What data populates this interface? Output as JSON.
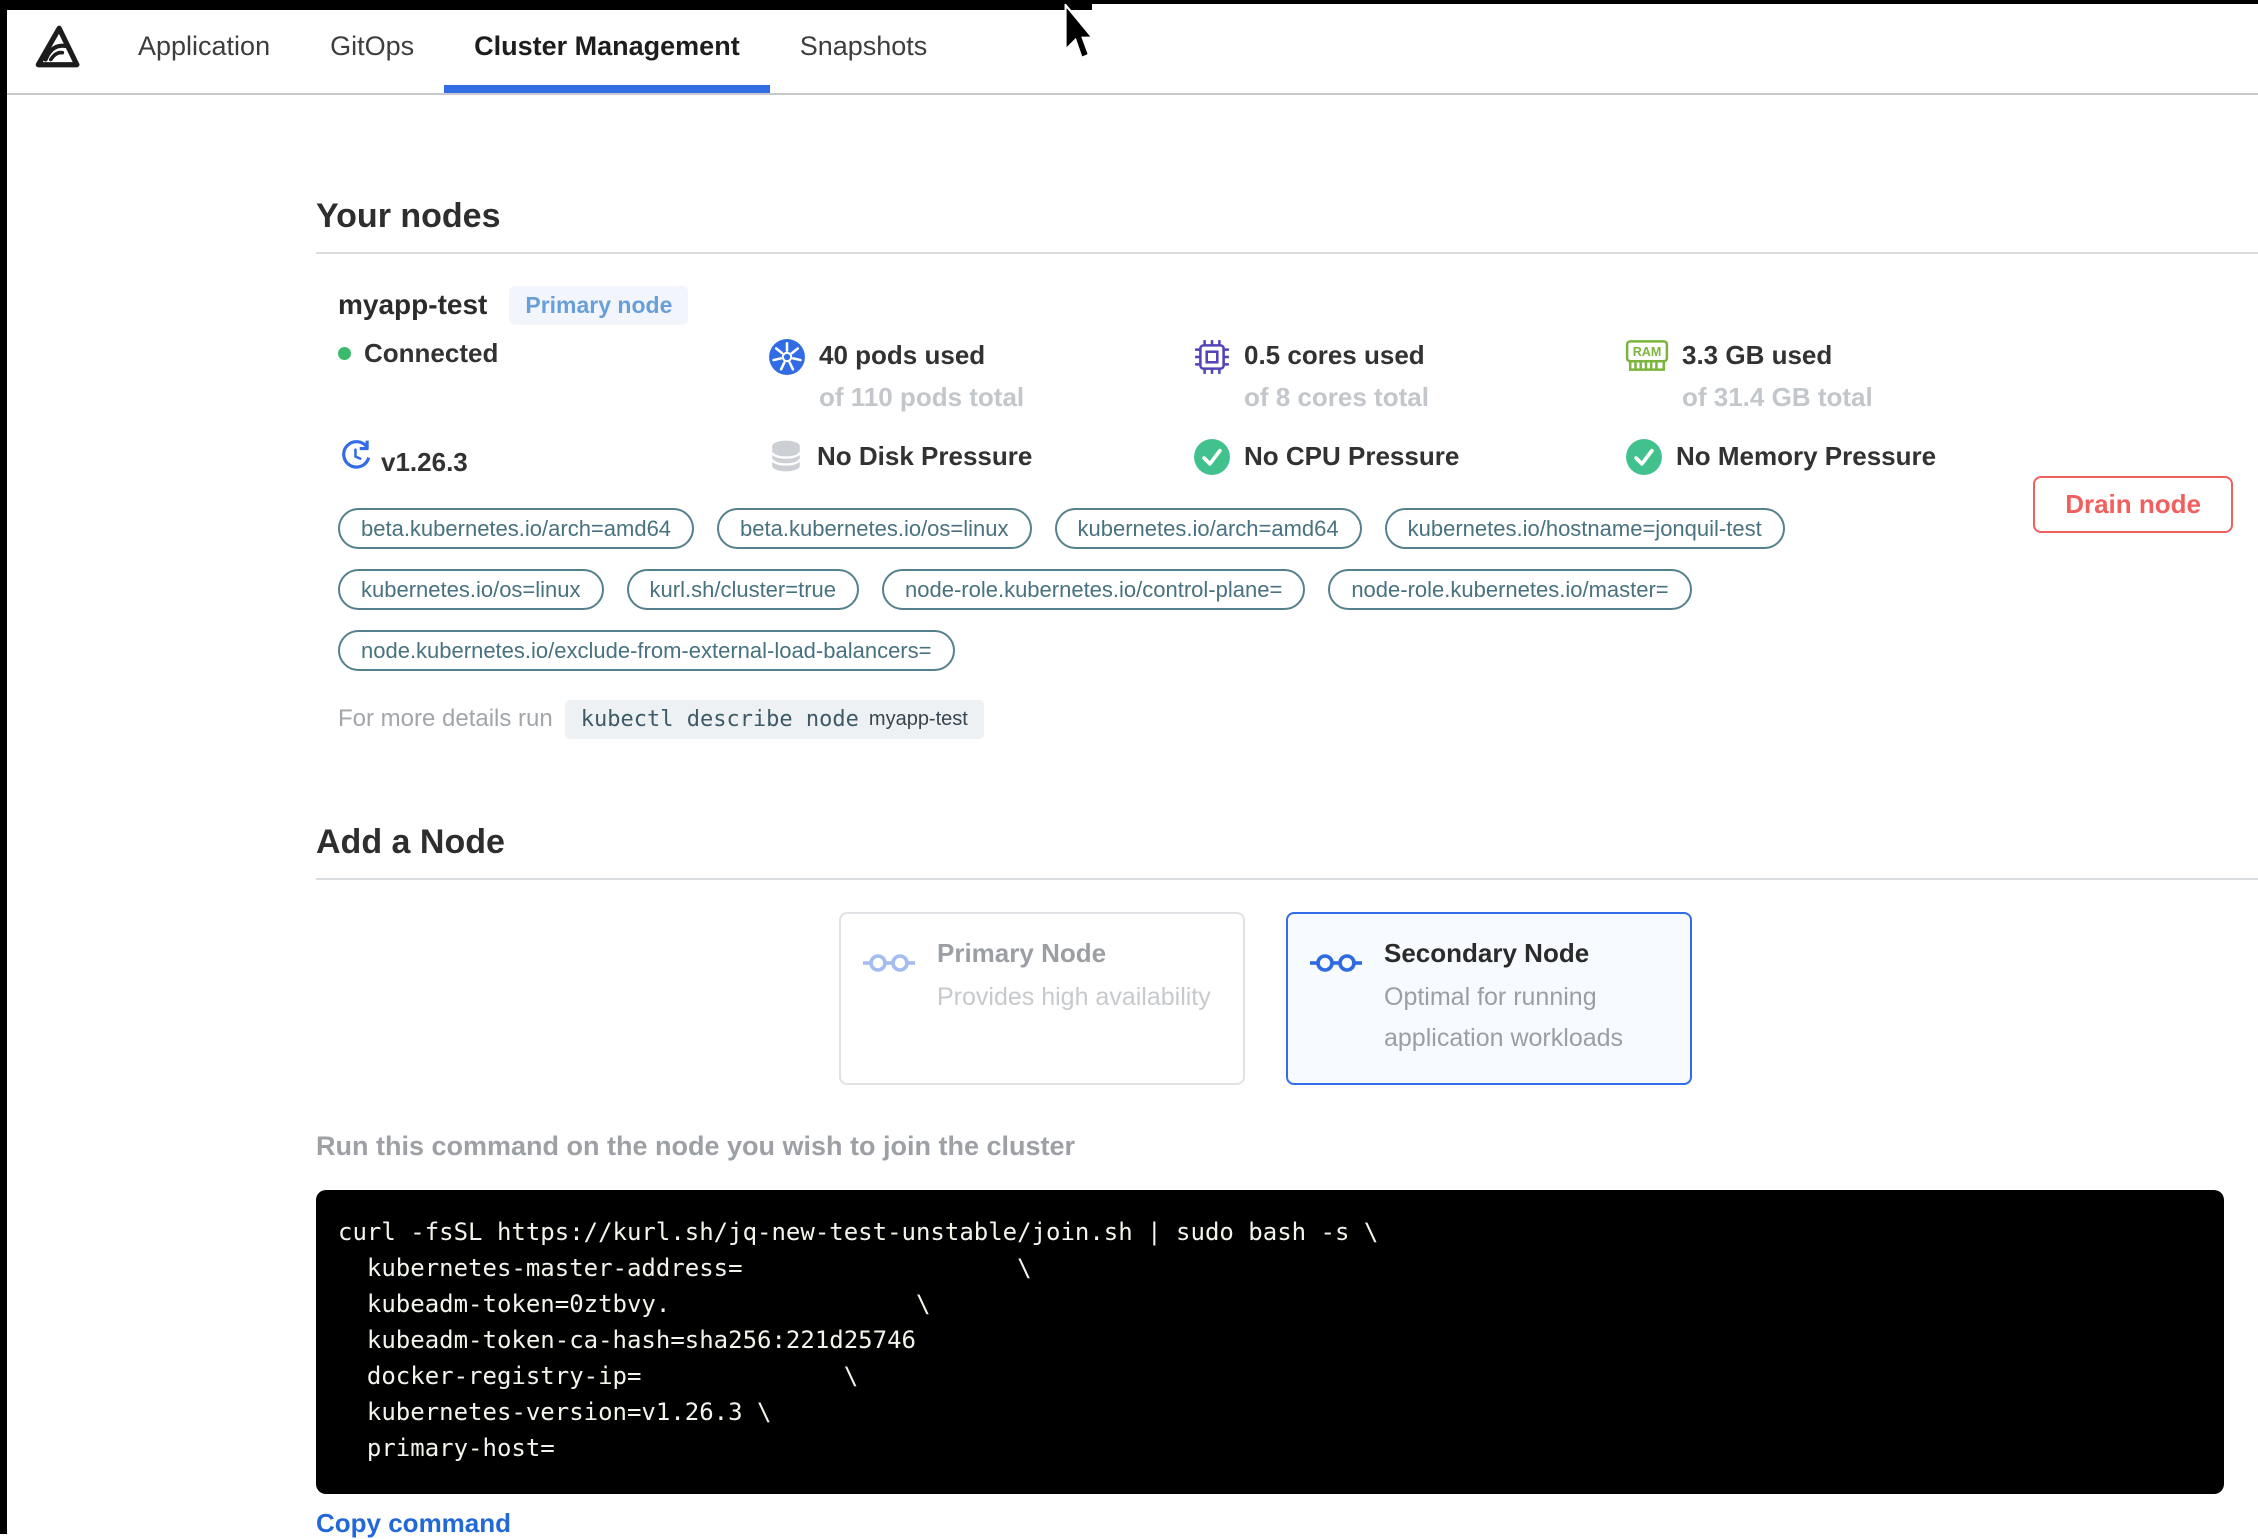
{
  "nav": {
    "tabs": [
      {
        "label": "Application",
        "active": false
      },
      {
        "label": "GitOps",
        "active": false
      },
      {
        "label": "Cluster Management",
        "active": true
      },
      {
        "label": "Snapshots",
        "active": false
      }
    ]
  },
  "your_nodes": {
    "title": "Your nodes",
    "node": {
      "name": "myapp-test",
      "badge": "Primary node",
      "status": "Connected",
      "stats": [
        {
          "icon": "kubernetes-pods-icon",
          "value": "40 pods used",
          "sub": "of 110 pods total"
        },
        {
          "icon": "cpu-chip-icon",
          "value": "0.5 cores used",
          "sub": "of 8 cores total"
        },
        {
          "icon": "ram-icon",
          "value": "3.3 GB used",
          "sub": "of 31.4 GB total"
        }
      ],
      "conditions": [
        {
          "icon": "version-refresh-icon",
          "label": "v1.26.3"
        },
        {
          "icon": "disk-cylinder-icon",
          "label": "No Disk Pressure"
        },
        {
          "icon": "check-circle-icon",
          "label": "No CPU Pressure"
        },
        {
          "icon": "check-circle-icon",
          "label": "No Memory Pressure"
        }
      ],
      "labels": [
        "beta.kubernetes.io/arch=amd64",
        "beta.kubernetes.io/os=linux",
        "kubernetes.io/arch=amd64",
        "kubernetes.io/hostname=jonquil-test",
        "kubernetes.io/os=linux",
        "kurl.sh/cluster=true",
        "node-role.kubernetes.io/control-plane=",
        "node-role.kubernetes.io/master=",
        "node.kubernetes.io/exclude-from-external-load-balancers="
      ],
      "details_prefix": "For more details run",
      "details_command": "kubectl describe node",
      "details_node": "myapp-test",
      "drain_button": "Drain node"
    }
  },
  "add_node": {
    "title": "Add a Node",
    "options": [
      {
        "title": "Primary Node",
        "description": "Provides high availability",
        "selected": false
      },
      {
        "title": "Secondary Node",
        "description": "Optimal for running application workloads",
        "selected": true
      }
    ],
    "instruction": "Run this command on the node you wish to join the cluster",
    "command_lines": [
      "curl -fsSL https://kurl.sh/jq-new-test-unstable/join.sh | sudo bash -s \\",
      "  kubernetes-master-address=                   \\",
      "  kubeadm-token=0ztbvy.                 \\",
      "  kubeadm-token-ca-hash=sha256:221d25746",
      "  docker-registry-ip=              \\",
      "  kubernetes-version=v1.26.3 \\",
      "  primary-host="
    ],
    "copy_label": "Copy command"
  },
  "colors": {
    "accent_blue": "#326de6",
    "kubernetes_blue": "#326ce5",
    "cpu_indigo": "#5044b8",
    "ram_green": "#7cb53e",
    "status_green": "#3cba6c",
    "check_green": "#41c18c",
    "pill_teal": "#48727f",
    "drain_red": "#f25f5f",
    "link_blue": "#2368d8",
    "badge_text": "#689fd9",
    "badge_bg": "#f2f5fb",
    "code_bg": "#000000"
  }
}
